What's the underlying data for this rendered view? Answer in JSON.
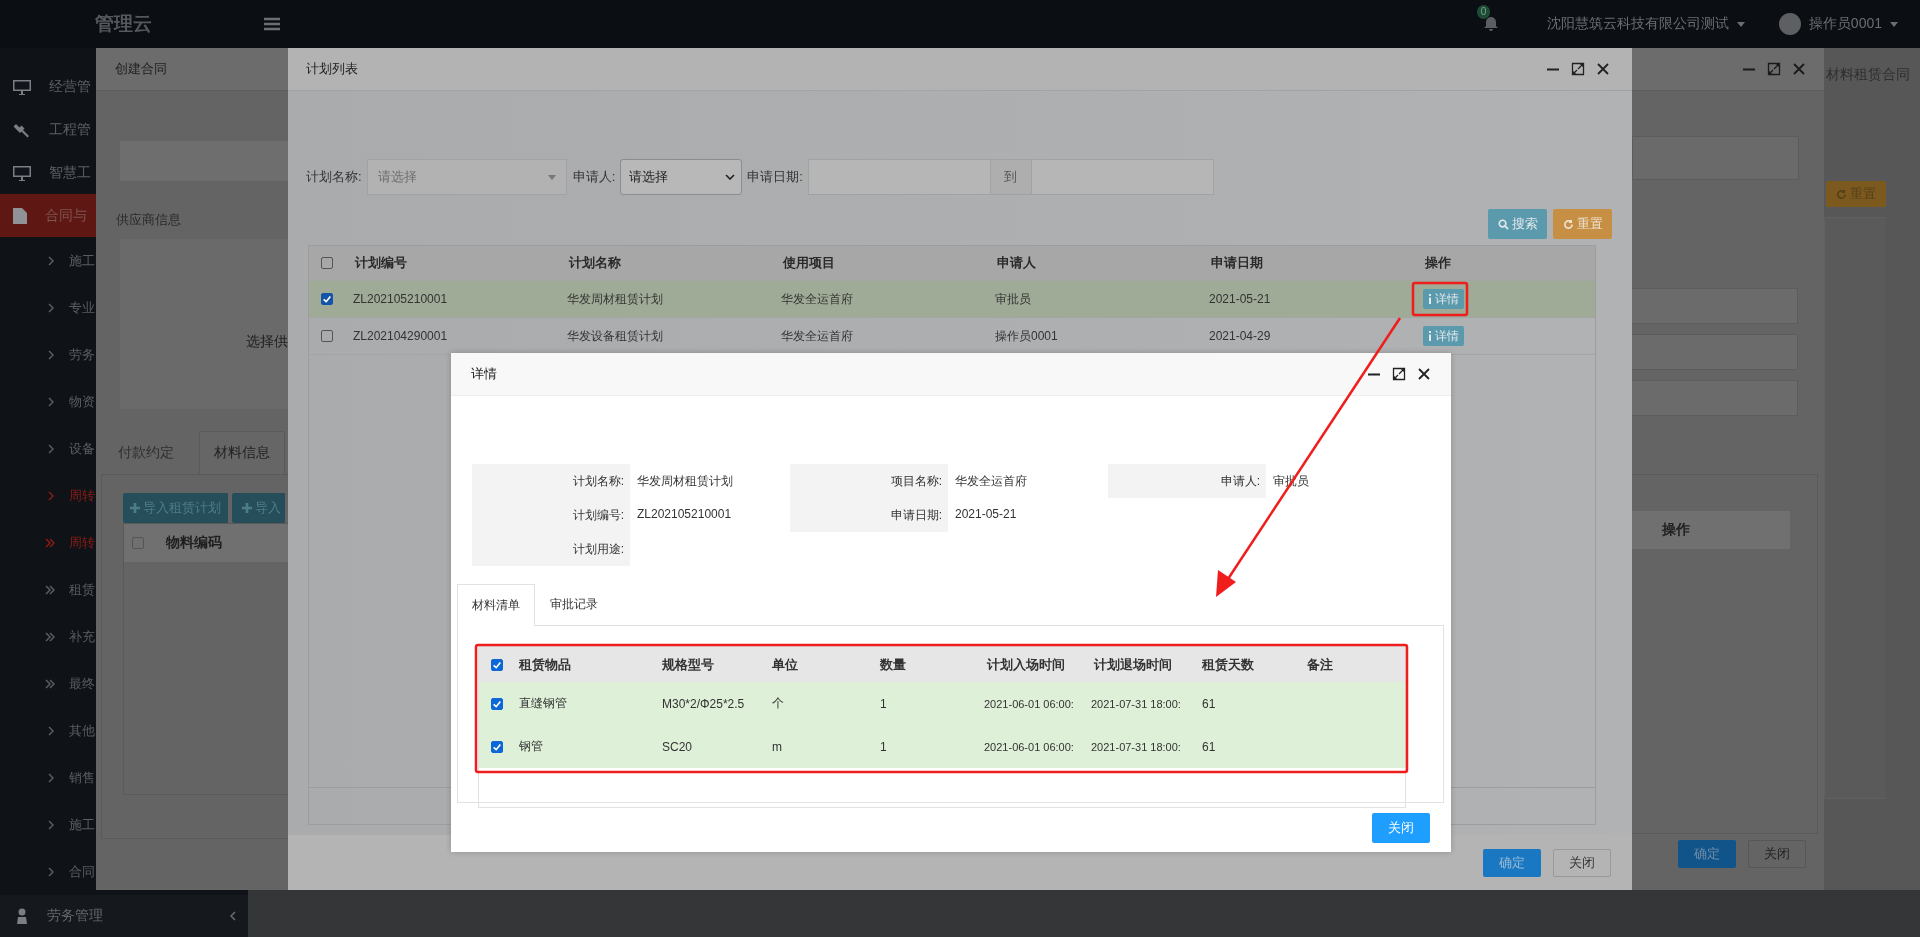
{
  "top_bar": {
    "logo": "管理云",
    "notification_count": "0",
    "company": "沈阳慧筑云科技有限公司测试",
    "user": "操作员0001"
  },
  "sidebar": {
    "items": [
      {
        "label": "经营管",
        "kind": "main",
        "selected": false,
        "highlighted": false
      },
      {
        "label": "工程管",
        "kind": "main",
        "selected": false,
        "highlighted": false
      },
      {
        "label": "智慧工",
        "kind": "main",
        "selected": false,
        "highlighted": false
      },
      {
        "label": "合同与",
        "kind": "main",
        "selected": true,
        "highlighted": false
      },
      {
        "label": "施工",
        "kind": "sub",
        "selected": false,
        "highlighted": false
      },
      {
        "label": "专业",
        "kind": "sub",
        "selected": false,
        "highlighted": false
      },
      {
        "label": "劳务",
        "kind": "sub",
        "selected": false,
        "highlighted": false
      },
      {
        "label": "物资",
        "kind": "sub",
        "selected": false,
        "highlighted": false
      },
      {
        "label": "设备",
        "kind": "sub",
        "selected": false,
        "highlighted": false
      },
      {
        "label": "周转",
        "kind": "sub",
        "selected": false,
        "highlighted": true
      },
      {
        "label": "周转",
        "kind": "group",
        "selected": false,
        "highlighted": true
      },
      {
        "label": "租赁",
        "kind": "group",
        "selected": false,
        "highlighted": false
      },
      {
        "label": "补充",
        "kind": "group",
        "selected": false,
        "highlighted": false
      },
      {
        "label": "最终",
        "kind": "group",
        "selected": false,
        "highlighted": false
      },
      {
        "label": "其他",
        "kind": "sub",
        "selected": false,
        "highlighted": false
      },
      {
        "label": "销售",
        "kind": "sub",
        "selected": false,
        "highlighted": false
      },
      {
        "label": "施工",
        "kind": "sub",
        "selected": false,
        "highlighted": false
      },
      {
        "label": "合同",
        "kind": "sub",
        "selected": false,
        "highlighted": false
      }
    ],
    "bottom_item": "劳务管理"
  },
  "background_page": {
    "tab_title": "材料租赁合同",
    "reset_button": "重置"
  },
  "create_contract_dialog": {
    "title": "创建合同",
    "section_title": "供应商信息",
    "supplier_label": "选择供",
    "tabs": [
      {
        "label": "付款约定",
        "selected": false
      },
      {
        "label": "材料信息",
        "selected": true
      }
    ],
    "toolbar_buttons": [
      "导入租赁计划",
      "导入"
    ],
    "material_columns": [
      "物料编码",
      "操作"
    ],
    "header_checked": false,
    "footer_buttons": [
      "确定",
      "关闭"
    ]
  },
  "plan_list_dialog": {
    "title": "计划列表",
    "filters": [
      {
        "label": "计划名称:",
        "kind": "select",
        "placeholder": "请选择"
      },
      {
        "label": "申请人:",
        "kind": "native-select",
        "value": "请选择"
      },
      {
        "label": "申请日期:",
        "kind": "range",
        "separator": "到"
      }
    ],
    "search_button": "搜索",
    "reset_button": "重置",
    "columns": [
      "计划编号",
      "计划名称",
      "使用项目",
      "申请人",
      "申请日期",
      "操作"
    ],
    "header_checked": false,
    "rows": [
      {
        "selected": true,
        "cells": [
          "ZL202105210001",
          "华发周材租赁计划",
          "华发全运首府",
          "审批员",
          "2021-05-21"
        ],
        "action": "详情"
      },
      {
        "selected": false,
        "cells": [
          "ZL202104290001",
          "华发设备租赁计划",
          "华发全运首府",
          "操作员0001",
          "2021-04-29"
        ],
        "action": "详情"
      }
    ],
    "footer_buttons": [
      "确定",
      "关闭"
    ]
  },
  "detail_dialog": {
    "title": "详情",
    "field_rows": [
      [
        {
          "label": "计划名称:",
          "value": "华发周材租赁计划"
        },
        {
          "label": "项目名称:",
          "value": "华发全运首府"
        },
        {
          "label": "申请人:",
          "value": "审批员"
        }
      ],
      [
        {
          "label": "计划编号:",
          "value": "ZL202105210001"
        },
        {
          "label": "申请日期:",
          "value": "2021-05-21"
        }
      ],
      [
        {
          "label": "计划用途:"
        }
      ]
    ],
    "tabs": [
      {
        "label": "材料清单",
        "selected": true
      },
      {
        "label": "审批记录",
        "selected": false
      }
    ],
    "columns": [
      "租赁物品",
      "规格型号",
      "单位",
      "数量",
      "计划入场时间",
      "计划退场时间",
      "租赁天数",
      "备注"
    ],
    "header_checked": true,
    "rows": [
      {
        "selected": true,
        "cells": [
          "直缝钢管",
          "M30*2/Φ25*2.5",
          "个",
          "1",
          "2021-06-01 06:00:",
          "2021-07-31 18:00:",
          "61"
        ]
      },
      {
        "selected": true,
        "cells": [
          "钢管",
          "SC20",
          "m",
          "1",
          "2021-06-01 06:00:",
          "2021-07-31 18:00:",
          "61"
        ]
      }
    ],
    "close_button": "关闭"
  }
}
